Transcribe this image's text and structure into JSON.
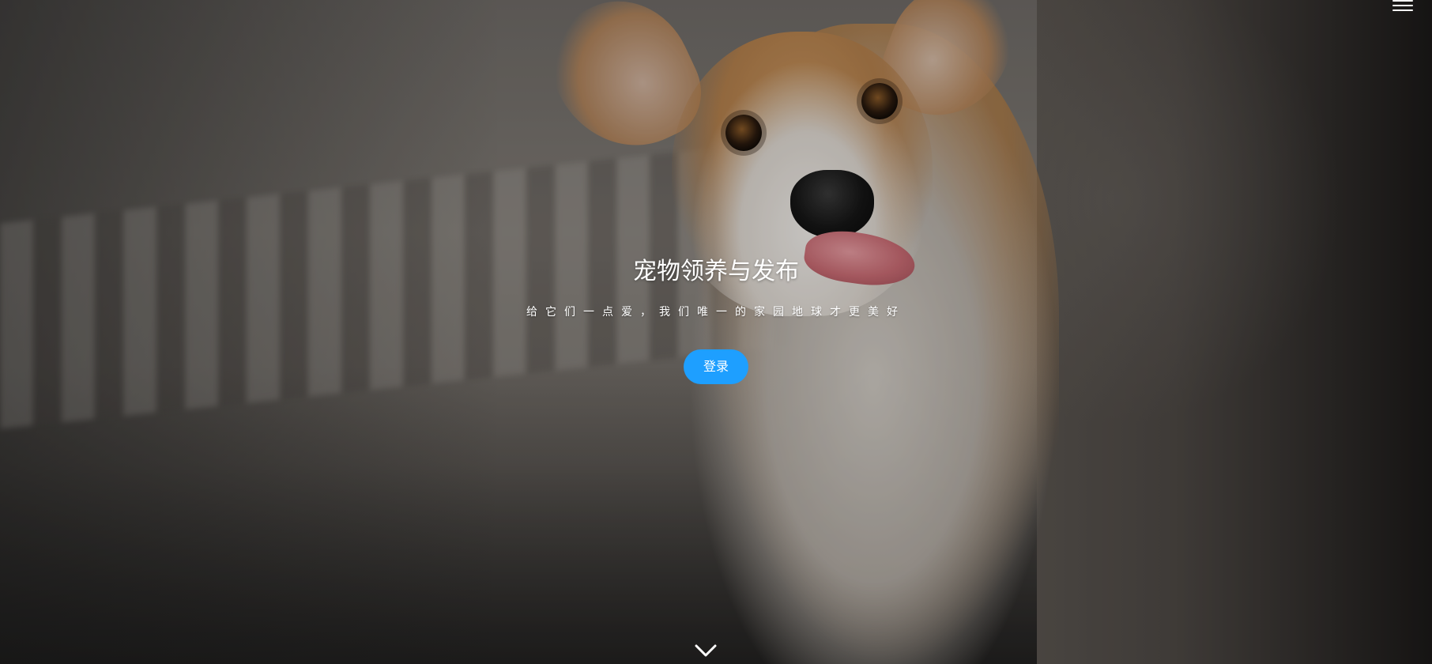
{
  "hero": {
    "title": "宠物领养与发布",
    "subtitle": "给它们一点爱，我们唯一的家园地球才更美好",
    "login_label": "登录",
    "accent_color": "#1e9fff"
  },
  "icons": {
    "menu": "hamburger-menu-icon",
    "scroll": "chevron-down-icon"
  }
}
